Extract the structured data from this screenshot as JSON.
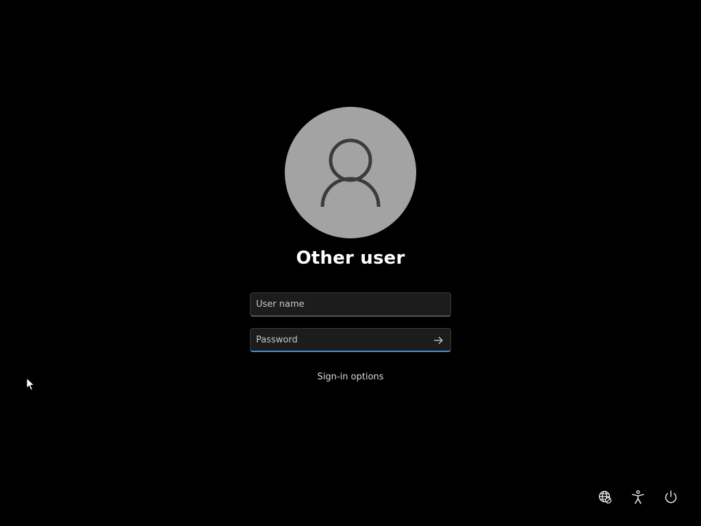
{
  "user": {
    "display_name": "Other user"
  },
  "fields": {
    "username_placeholder": "User name",
    "password_placeholder": "Password"
  },
  "links": {
    "signin_options": "Sign-in options"
  },
  "icons": {
    "avatar": "person-icon",
    "submit": "arrow-right-icon",
    "network": "network-globe-icon",
    "accessibility": "accessibility-icon",
    "power": "power-icon"
  },
  "colors": {
    "background": "#000000",
    "avatar_bg": "#a3a3a3",
    "focus_accent": "#4a8fd8"
  }
}
